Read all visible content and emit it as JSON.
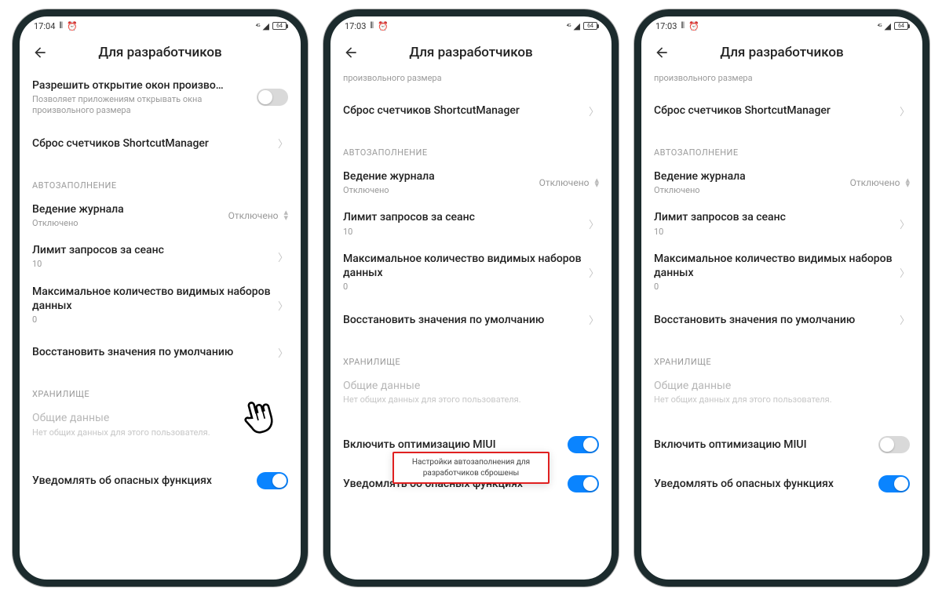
{
  "phones": [
    {
      "time": "17:04",
      "battery": "64",
      "title": "Для разработчиков",
      "topCut": null,
      "allowResize": {
        "title": "Разрешить открытие окон произво…",
        "sub": "Позволяет приложениям открывать окна произвольного размера",
        "on": false
      },
      "resetShortcut": "Сброс счетчиков ShortcutManager",
      "sectionAutofill": "АВТОЗАПОЛНЕНИЕ",
      "logging": {
        "title": "Ведение журнала",
        "sub": "Отключено",
        "val": "Отключено"
      },
      "limit": {
        "title": "Лимит запросов за сеанс",
        "sub": "10"
      },
      "maxData": {
        "title": "Максимальное количество видимых наборов данных",
        "sub": "0"
      },
      "restore": "Восстановить значения по умолчанию",
      "sectionStorage": "ХРАНИЛИЩЕ",
      "shared": {
        "title": "Общие данные",
        "sub": "Нет общих данных для этого пользователя."
      },
      "miui": null,
      "danger": {
        "title": "Уведомлять об опасных функциях",
        "on": true
      },
      "toast": null,
      "showHand": true
    },
    {
      "time": "17:03",
      "battery": "64",
      "title": "Для разработчиков",
      "topCut": "произвольного размера",
      "allowResize": null,
      "resetShortcut": "Сброс счетчиков ShortcutManager",
      "sectionAutofill": "АВТОЗАПОЛНЕНИЕ",
      "logging": {
        "title": "Ведение журнала",
        "sub": "Отключено",
        "val": "Отключено"
      },
      "limit": {
        "title": "Лимит запросов за сеанс",
        "sub": "10"
      },
      "maxData": {
        "title": "Максимальное количество видимых наборов данных",
        "sub": "0"
      },
      "restore": "Восстановить значения по умолчанию",
      "sectionStorage": "ХРАНИЛИЩЕ",
      "shared": {
        "title": "Общие данные",
        "sub": "Нет общих данных для этого пользователя."
      },
      "miui": {
        "title": "Включить оптимизацию MIUI",
        "on": true
      },
      "danger": {
        "title": "Уведомлять об опасных функциях",
        "on": true
      },
      "toast": "Настройки автозаполнения для разработчиков сброшены",
      "showHand": false
    },
    {
      "time": "17:03",
      "battery": "64",
      "title": "Для разработчиков",
      "topCut": "произвольного размера",
      "allowResize": null,
      "resetShortcut": "Сброс счетчиков ShortcutManager",
      "sectionAutofill": "АВТОЗАПОЛНЕНИЕ",
      "logging": {
        "title": "Ведение журнала",
        "sub": "Отключено",
        "val": "Отключено"
      },
      "limit": {
        "title": "Лимит запросов за сеанс",
        "sub": "10"
      },
      "maxData": {
        "title": "Максимальное количество видимых наборов данных",
        "sub": "0"
      },
      "restore": "Восстановить значения по умолчанию",
      "sectionStorage": "ХРАНИЛИЩЕ",
      "shared": {
        "title": "Общие данные",
        "sub": "Нет общих данных для этого пользователя."
      },
      "miui": {
        "title": "Включить оптимизацию MIUI",
        "on": false
      },
      "danger": {
        "title": "Уведомлять об опасных функциях",
        "on": true
      },
      "toast": null,
      "showHand": false
    }
  ]
}
